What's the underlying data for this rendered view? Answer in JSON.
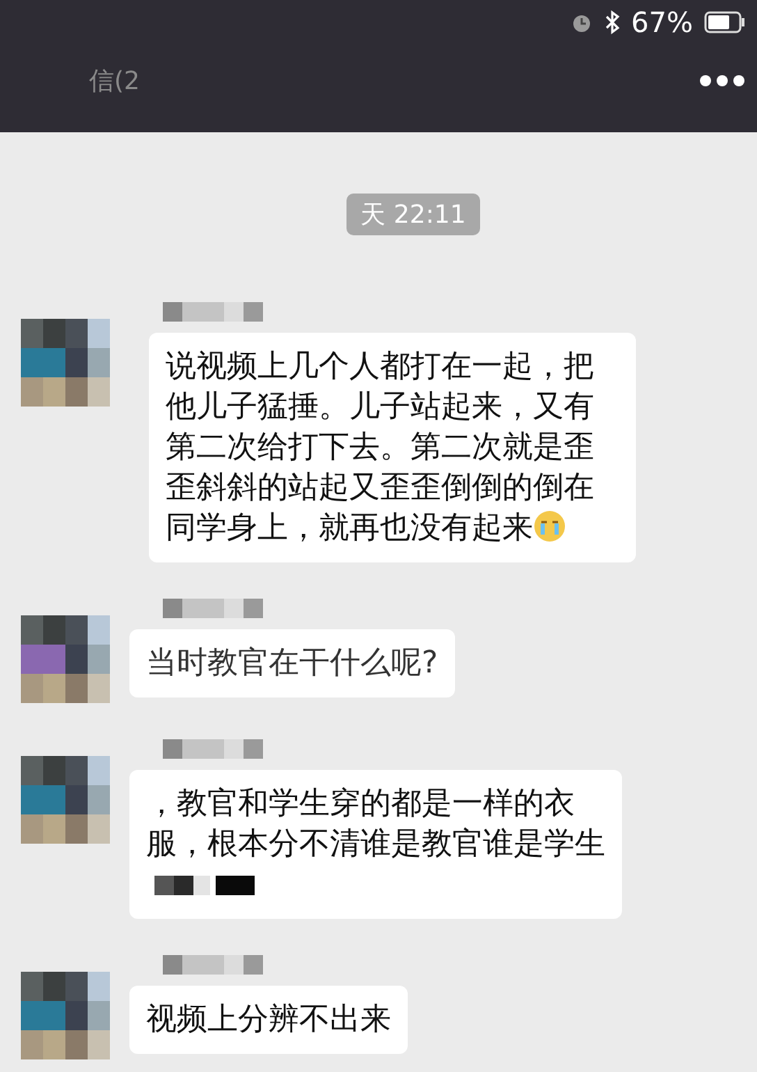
{
  "status_bar": {
    "battery": "67%"
  },
  "nav": {
    "back": "信(2"
  },
  "timestamp": "天 22:11",
  "messages": [
    {
      "text": "说视频上几个人都打在一起，把他儿子猛捶。儿子站起来，又有第二次给打下去。第二次就是歪歪斜斜的站起又歪歪倒倒的倒在同学身上，就再也没有起来",
      "kind": "emoji",
      "avatar": {
        "color": "#2a7a98"
      }
    },
    {
      "text": "当时教官在干什么呢?",
      "kind": "plain",
      "avatar": {
        "color": "#8a68b0"
      }
    },
    {
      "text": "，教官和学生穿的都是一样的衣服，根本分不清谁是教官谁是学生",
      "kind": "pixelated",
      "avatar": {
        "color": "#2a7a98"
      }
    },
    {
      "text": "视频上分辨不出来",
      "kind": "plain",
      "avatar": {
        "color": "#2a7a98"
      }
    }
  ]
}
